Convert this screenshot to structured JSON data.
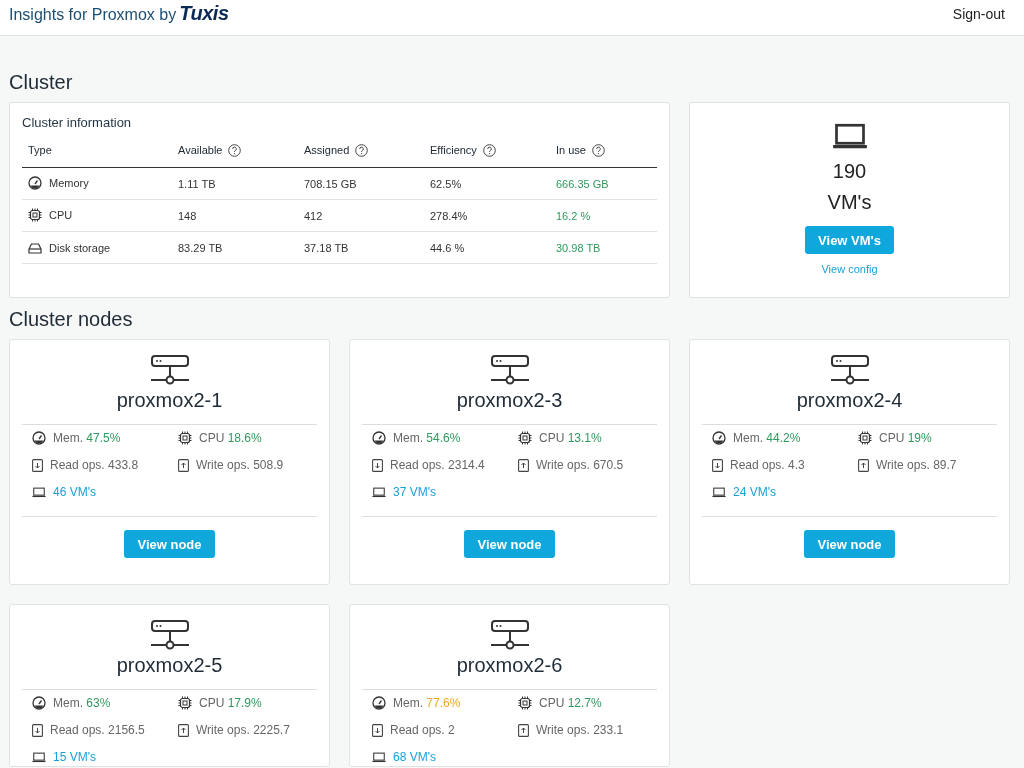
{
  "header": {
    "title": "Insights for Proxmox by",
    "logo": "Tuxis",
    "signout": "Sign-out"
  },
  "cluster": {
    "heading": "Cluster",
    "info": {
      "title": "Cluster information",
      "columns": [
        "Type",
        "Available",
        "Assigned",
        "Efficiency",
        "In use"
      ],
      "rows": [
        {
          "kind": "memory",
          "cells": [
            "Memory",
            "1.11 TB",
            "708.15 GB",
            "62.5%",
            "666.35 GB"
          ]
        },
        {
          "kind": "cpu",
          "cells": [
            "CPU",
            "148",
            "412",
            "278.4%",
            "16.2 %"
          ]
        },
        {
          "kind": "disk",
          "cells": [
            "Disk storage",
            "83.29 TB",
            "37.18 TB",
            "44.6 %",
            "30.98 TB"
          ]
        }
      ]
    },
    "vms": {
      "count": "190",
      "label": "VM's",
      "button": "View VM's",
      "link": "View config"
    }
  },
  "nodes_heading": "Cluster nodes",
  "nodes": [
    {
      "name": "proxmox2-1",
      "mem": {
        "label": "Mem.",
        "value": "47.5%",
        "color": "#2e9a5e"
      },
      "cpu": {
        "label": "CPU",
        "value": "18.6%",
        "color": "#2e9a5e"
      },
      "read": "Read ops. 433.8",
      "write": "Write ops. 508.9",
      "vms": "46 VM's",
      "button": "View node"
    },
    {
      "name": "proxmox2-3",
      "mem": {
        "label": "Mem.",
        "value": "54.6%",
        "color": "#2e9a5e"
      },
      "cpu": {
        "label": "CPU",
        "value": "13.1%",
        "color": "#2e9a5e"
      },
      "read": "Read ops. 2314.4",
      "write": "Write ops. 670.5",
      "vms": "37 VM's",
      "button": "View node"
    },
    {
      "name": "proxmox2-4",
      "mem": {
        "label": "Mem.",
        "value": "44.2%",
        "color": "#2e9a5e"
      },
      "cpu": {
        "label": "CPU",
        "value": "19%",
        "color": "#2e9a5e"
      },
      "read": "Read ops. 4.3",
      "write": "Write ops. 89.7",
      "vms": "24 VM's",
      "button": "View node"
    },
    {
      "name": "proxmox2-5",
      "mem": {
        "label": "Mem.",
        "value": "63%",
        "color": "#2e9a5e"
      },
      "cpu": {
        "label": "CPU",
        "value": "17.9%",
        "color": "#2e9a5e"
      },
      "read": "Read ops. 2156.5",
      "write": "Write ops. 2225.7",
      "vms": "15 VM's"
    },
    {
      "name": "proxmox2-6",
      "mem": {
        "label": "Mem.",
        "value": "77.6%",
        "color": "#f0a81c"
      },
      "cpu": {
        "label": "CPU",
        "value": "12.7%",
        "color": "#2e9a5e"
      },
      "read": "Read ops. 2",
      "write": "Write ops. 233.1",
      "vms": "68 VM's"
    }
  ]
}
